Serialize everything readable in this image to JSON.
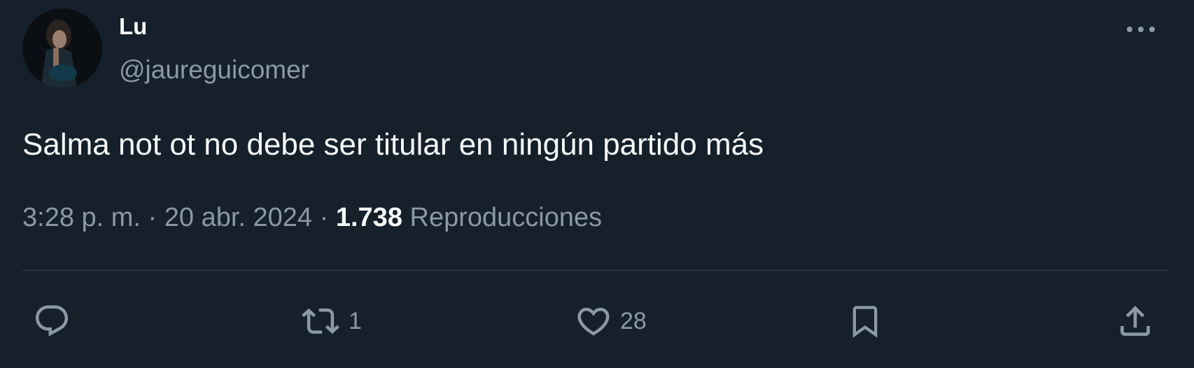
{
  "author": {
    "display_name": "Lu",
    "handle": "@jaureguicomer"
  },
  "tweet": {
    "text": "Salma not ot no debe ser titular en ningún partido más",
    "time": "3:28 p. m.",
    "date": "20 abr. 2024",
    "separator": "·",
    "views_count": "1.738",
    "views_label": "Reproducciones"
  },
  "actions": {
    "reply_icon": "reply-icon",
    "retweet_icon": "retweet-icon",
    "retweet_count": "1",
    "like_icon": "heart-icon",
    "like_count": "28",
    "bookmark_icon": "bookmark-icon",
    "share_icon": "share-icon",
    "more_icon": "more-options-icon"
  },
  "colors": {
    "background": "#15202b",
    "primary_text": "#f7f9f9",
    "secondary_text": "#8b98a5",
    "divider": "#38444d"
  }
}
